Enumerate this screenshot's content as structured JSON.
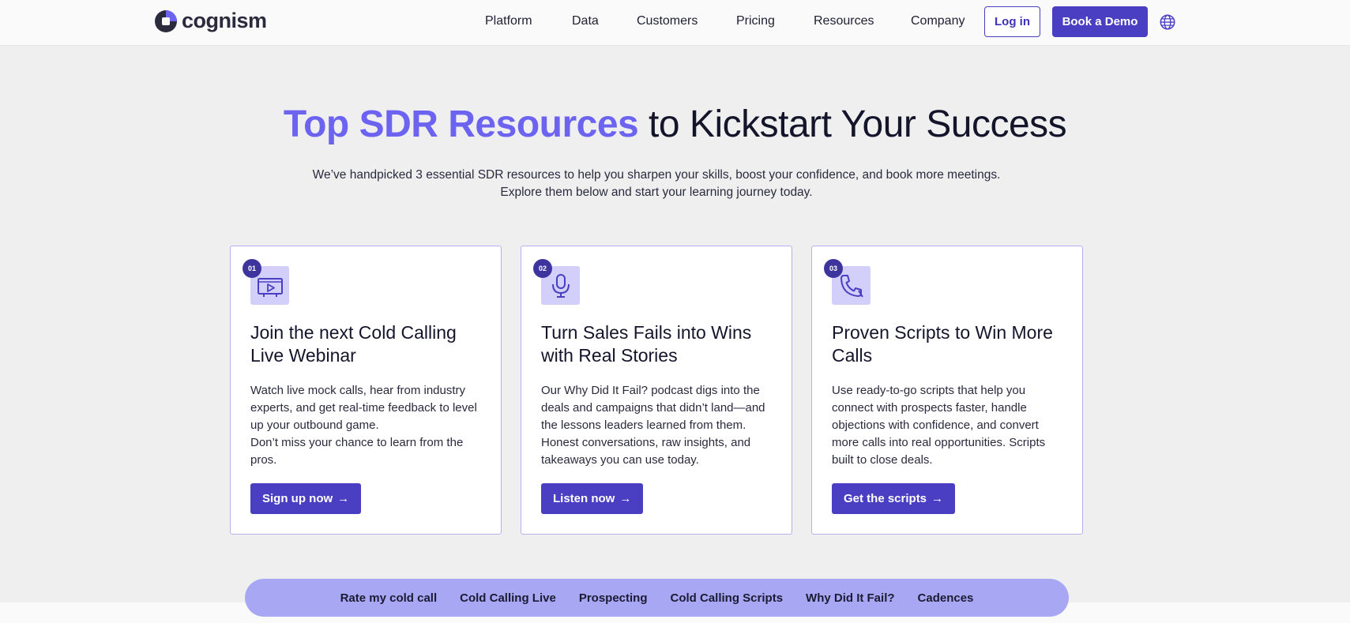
{
  "header": {
    "logo_text": "cognism",
    "nav": [
      "Platform",
      "Data",
      "Customers",
      "Pricing",
      "Resources",
      "Company"
    ],
    "login_label": "Log in",
    "demo_label": "Book a Demo",
    "globe_icon": "globe-icon"
  },
  "hero": {
    "title_accent": "Top SDR Resources",
    "title_rest": " to Kickstart Your Success",
    "subtitle_line1": "We’ve handpicked 3 essential SDR resources to help you sharpen your skills, boost your confidence, and book more meetings.",
    "subtitle_line2": "Explore them below and start your learning journey today."
  },
  "cards": [
    {
      "number": "01",
      "icon": "video-icon",
      "title": "Join the next Cold Calling Live Webinar",
      "body": "Watch live mock calls, hear from industry experts, and get real-time feedback to level up your outbound game.\nDon’t miss your chance to learn from the pros.",
      "button": "Sign up now"
    },
    {
      "number": "02",
      "icon": "microphone-icon",
      "title": "Turn Sales Fails into Wins with Real Stories",
      "body": "Our Why Did It Fail? podcast digs into the deals and campaigns that didn’t land—and the lessons leaders learned from them. Honest conversations, raw insights, and takeaways you can use today.",
      "button": "Listen now"
    },
    {
      "number": "03",
      "icon": "phone-icon",
      "title": "Proven Scripts to Win More Calls",
      "body": "Use ready-to-go scripts that help you connect with prospects faster, handle objections with confidence, and convert more calls into real opportunities. Scripts built to close deals.",
      "button": "Get the scripts"
    }
  ],
  "subnav": [
    "Rate my cold call",
    "Cold Calling Live",
    "Prospecting",
    "Cold Calling Scripts",
    "Why Did It Fail?",
    "Cadences"
  ],
  "colors": {
    "accent": "#6c63f0",
    "primary_button": "#4a3fc2",
    "pill_background": "#a8a7f4",
    "card_border": "#b6b0f2",
    "icon_tile": "#d2cffa"
  }
}
